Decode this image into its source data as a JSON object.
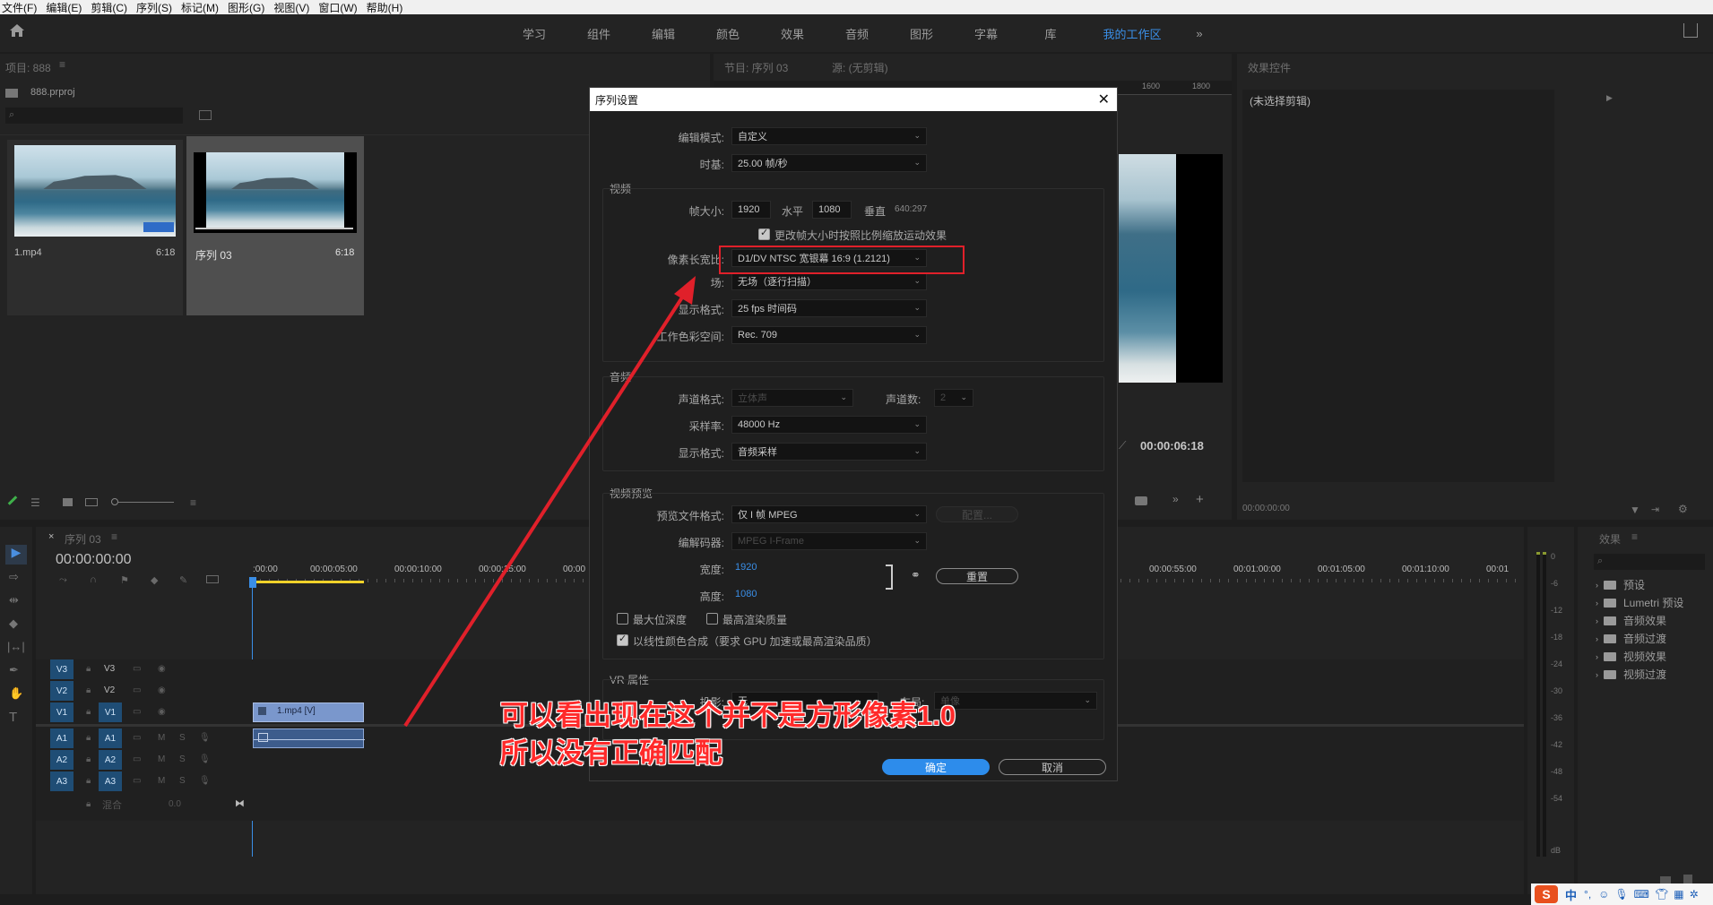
{
  "menu": [
    "文件(F)",
    "编辑(E)",
    "剪辑(C)",
    "序列(S)",
    "标记(M)",
    "图形(G)",
    "视图(V)",
    "窗口(W)",
    "帮助(H)"
  ],
  "workspaces": [
    "学习",
    "组件",
    "编辑",
    "颜色",
    "效果",
    "音频",
    "图形",
    "字幕",
    "库",
    "我的工作区"
  ],
  "workspace_active": "我的工作区",
  "project": {
    "title": "项目: 888",
    "file": "888.prproj",
    "items": [
      {
        "name": "1.mp4",
        "dur": "6:18"
      },
      {
        "name": "序列 03",
        "dur": "6:18"
      }
    ]
  },
  "program": {
    "title": "节目: 序列 03",
    "source": "源: (无剪辑)",
    "ruler_labels": [
      "1600",
      "1800"
    ],
    "timecode": "00:00:06:18"
  },
  "effect_controls": {
    "title": "效果控件",
    "no_clip": "(未选择剪辑)",
    "timecode": "00:00:00:00"
  },
  "timeline": {
    "tab": "序列 03",
    "timecode": "00:00:00:00",
    "ruler": [
      ":00:00",
      "00:00:05:00",
      "00:00:10:00",
      "00:00:15:00",
      "00:00",
      "00:00:55:00",
      "00:01:00:00",
      "00:01:05:00",
      "00:01:10:00",
      "00:01"
    ],
    "tracks_video": [
      "V3",
      "V2",
      "V1"
    ],
    "tracks_audio": [
      "A1",
      "A2",
      "A3"
    ],
    "src_v1": "V1",
    "src_a1": "A1",
    "clip_label": "1.mp4 [V]",
    "mix_label": "混合",
    "mix_value": "0.0"
  },
  "meter": {
    "labels": [
      "0",
      "-6",
      "-12",
      "-18",
      "-24",
      "-30",
      "-36",
      "-42",
      "-48",
      "-54",
      "dB"
    ]
  },
  "effects_panel": {
    "title": "效果",
    "items": [
      "预设",
      "Lumetri 预设",
      "音频效果",
      "音频过渡",
      "视频效果",
      "视频过渡"
    ]
  },
  "dialog": {
    "title": "序列设置",
    "edit_mode_label": "编辑模式:",
    "edit_mode": "自定义",
    "timebase_label": "时基:",
    "timebase": "25.00  帧/秒",
    "video_group": "视频",
    "frame_size_label": "帧大小:",
    "frame_w": "1920",
    "horiz": "水平",
    "frame_h": "1080",
    "vert": "垂直",
    "ratio": "640:297",
    "scale_cb": "更改帧大小时按照比例缩放运动效果",
    "par_label": "像素长宽比:",
    "par": "D1/DV NTSC 宽银幕 16:9 (1.2121)",
    "field_label": "场:",
    "field": "无场（逐行扫描）",
    "display_label": "显示格式:",
    "display": "25 fps 时间码",
    "color_label": "工作色彩空间:",
    "color": "Rec. 709",
    "audio_group": "音频",
    "ch_fmt_label": "声道格式:",
    "ch_fmt": "立体声",
    "ch_num_label": "声道数:",
    "ch_num": "2",
    "sample_label": "采样率:",
    "sample": "48000 Hz",
    "a_display_label": "显示格式:",
    "a_display": "音频采样",
    "preview_group": "视频预览",
    "pfmt_label": "预览文件格式:",
    "pfmt": "仅 I 帧 MPEG",
    "config_btn": "配置...",
    "codec_label": "编解码器:",
    "codec": "MPEG I-Frame",
    "width_label": "宽度:",
    "width": "1920",
    "height_label": "高度:",
    "height": "1080",
    "reset_btn": "重置",
    "max_depth": "最大位深度",
    "max_quality": "最高渲染质量",
    "linear_cb": "以线性颜色合成（要求 GPU 加速或最高渲染品质）",
    "vr_group": "VR 属性",
    "proj_label": "投影:",
    "proj": "无",
    "layout_label": "布局:",
    "layout": "单像",
    "ok_btn": "确定",
    "cancel_btn": "取消"
  },
  "annotation": {
    "line1": "可以看出现在这个并不是方形像素1.0",
    "line2": "所以没有正确匹配"
  },
  "ime": {
    "logo": "S",
    "lang": "中"
  }
}
